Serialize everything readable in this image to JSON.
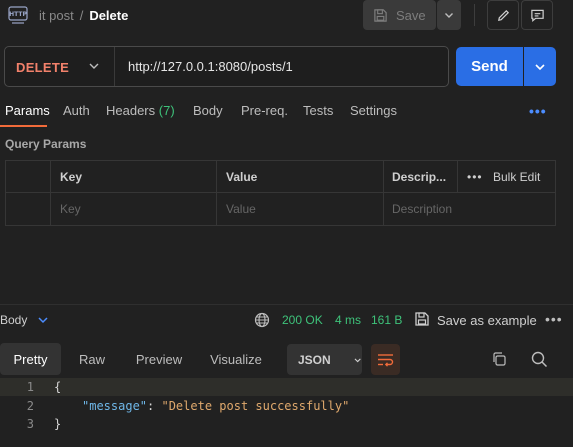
{
  "header": {
    "app_icon": "http-icon",
    "breadcrumb_parent": "it post",
    "breadcrumb_separator": "/",
    "breadcrumb_current": "Delete",
    "save_label": "Save"
  },
  "request": {
    "method": "DELETE",
    "url": "http://127.0.0.1:8080/posts/1",
    "send_label": "Send"
  },
  "tabs": [
    {
      "label": "Params",
      "active": true
    },
    {
      "label": "Auth"
    },
    {
      "label": "Headers",
      "count": "(7)"
    },
    {
      "label": "Body"
    },
    {
      "label": "Pre-req."
    },
    {
      "label": "Tests"
    },
    {
      "label": "Settings"
    }
  ],
  "more_label": "•••",
  "query_params": {
    "title": "Query Params",
    "columns": [
      "Key",
      "Value",
      "Descrip..."
    ],
    "bulk_edit_label": "Bulk Edit",
    "bulk_dots": "•••",
    "placeholders": {
      "key": "Key",
      "value": "Value",
      "description": "Description"
    }
  },
  "response": {
    "body_label": "Body",
    "status": "200 OK",
    "time": "4 ms",
    "size": "161 B",
    "save_example_label": "Save as example",
    "more_label": "•••",
    "view_tabs": [
      "Pretty",
      "Raw",
      "Preview",
      "Visualize"
    ],
    "format": "JSON",
    "code_lines": [
      {
        "num": "1",
        "text": "{"
      },
      {
        "num": "2",
        "key": "\"message\"",
        "colon": ": ",
        "value": "\"Delete post successfully\""
      },
      {
        "num": "3",
        "text": "}"
      }
    ]
  },
  "colors": {
    "method": "#f2816b",
    "send": "#2a6ee5",
    "status_ok": "#3ec27a",
    "active_tab_underline": "#f26b3a"
  }
}
